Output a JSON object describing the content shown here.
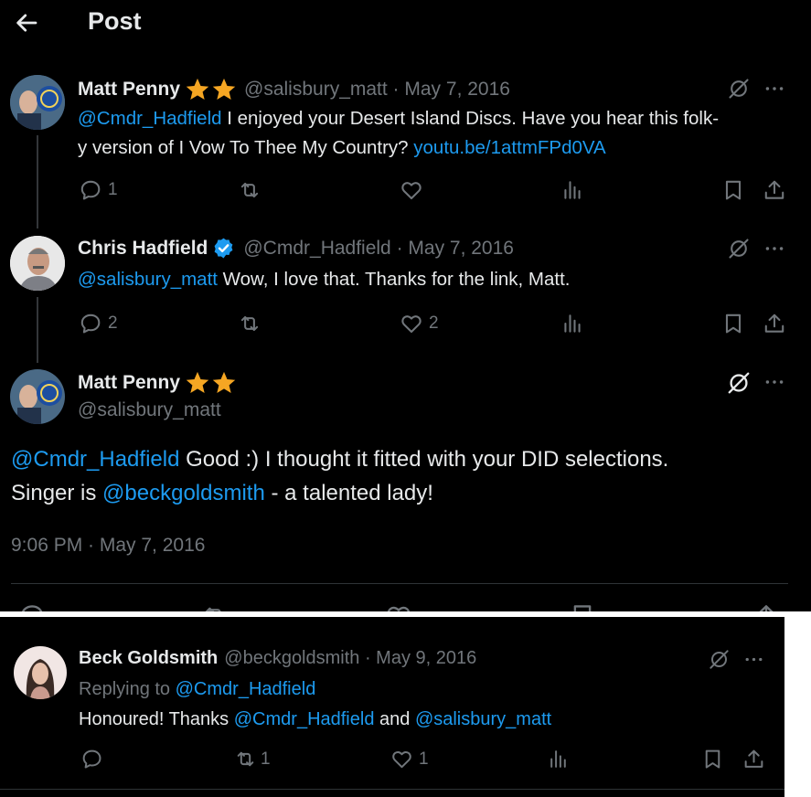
{
  "header": {
    "title": "Post"
  },
  "tweet1": {
    "name": "Matt Penny",
    "meta": "@salisbury_matt · May 7, 2016",
    "mention": "@Cmdr_Hadfield",
    "text_line1": " I enjoyed your Desert Island Discs. Have you hear this folk-",
    "text_line2": "y version of I Vow To Thee My Country? ",
    "link": "youtu.be/1attmFPd0VA",
    "replies": "1"
  },
  "tweet2": {
    "name": "Chris Hadfield",
    "meta": "@Cmdr_Hadfield · May 7, 2016",
    "mention": "@salisbury_matt",
    "text": " Wow, I love that. Thanks for the link, Matt.",
    "replies": "2",
    "likes": "2"
  },
  "main": {
    "name": "Matt Penny",
    "handle": "@salisbury_matt",
    "mention1": "@Cmdr_Hadfield",
    "text1": " Good :) I thought it fitted with your DID selections.",
    "text2_prefix": "Singer is ",
    "mention2": "@beckgoldsmith",
    "text2_suffix": " - a talented lady!",
    "timestamp": "9:06 PM · May 7, 2016"
  },
  "reply": {
    "name": "Beck Goldsmith",
    "meta": "@beckgoldsmith · May 9, 2016",
    "replying_prefix": "Replying to ",
    "replying_to": "@Cmdr_Hadfield",
    "text_prefix": "Honoured! Thanks ",
    "mention1": "@Cmdr_Hadfield",
    "text_mid": " and ",
    "mention2": "@salisbury_matt",
    "retweets": "1",
    "likes": "1"
  },
  "colors": {
    "background": "#000000",
    "accent": "#1d9bf0",
    "muted": "#71767b",
    "star": "#f5a623",
    "verified": "#1d9bf0"
  },
  "icons": [
    "back-arrow-icon",
    "grok-icon",
    "more-icon",
    "reply-icon",
    "retweet-icon",
    "like-icon",
    "views-icon",
    "bookmark-icon",
    "share-icon",
    "star-icon",
    "verified-icon"
  ]
}
